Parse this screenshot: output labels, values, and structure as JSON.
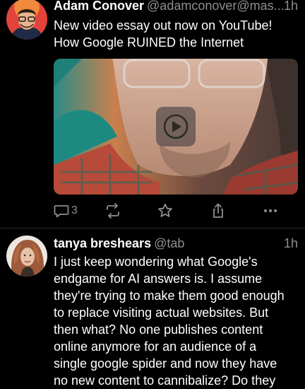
{
  "posts": [
    {
      "display_name": "Adam Conover",
      "handle": "@adamconover@mas...",
      "time": "1h",
      "body_lines": [
        "New video essay out now on YouTube!",
        "How Google RUINED the Internet"
      ],
      "has_video": true,
      "reply_count": "3"
    },
    {
      "display_name": "tanya breshears",
      "handle": "@tab",
      "time": "1h",
      "body_lines": [
        "I just keep wondering what Google's",
        "endgame for AI answers is. I assume",
        "they're trying to make them good enough",
        "to replace visiting actual websites. But",
        "then what? No one publishes content",
        "online anymore for an audience of a",
        "single google spider and now they have",
        "no new content to cannibalize? Do they"
      ]
    }
  ],
  "icons": {
    "reply": "reply-icon",
    "boost": "boost-icon",
    "favourite": "star-icon",
    "share": "share-icon",
    "more": "more-icon",
    "play": "play-icon"
  },
  "colors": {
    "background": "#000000",
    "primary_text": "#ffffff",
    "secondary_text": "#8e8e93",
    "divider": "#2a2a2a"
  }
}
